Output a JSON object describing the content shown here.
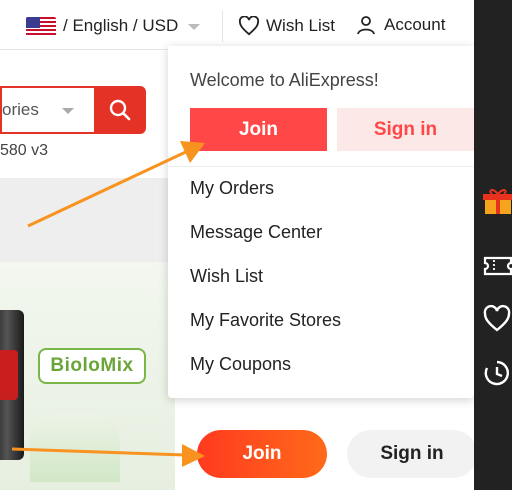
{
  "topbar": {
    "language": "/ English /  USD",
    "wish_list": "Wish List",
    "account": "Account"
  },
  "search": {
    "category": "ories",
    "below_text": "580 v3"
  },
  "product": {
    "brand": "BioloMix"
  },
  "dropdown": {
    "welcome": "Welcome to AliExpress!",
    "join": "Join",
    "sign_in": "Sign in",
    "items": [
      "My Orders",
      "Message Center",
      "Wish List",
      "My Favorite Stores",
      "My Coupons"
    ]
  },
  "bottom": {
    "join": "Join",
    "sign_in": "Sign in"
  },
  "sidebar": {
    "icons": [
      "gift-icon",
      "coupon-icon",
      "heart-icon",
      "history-icon"
    ]
  },
  "colors": {
    "brand_red": "#ff4747",
    "search_red": "#e43226",
    "arrow_orange": "#f7931e",
    "sidebar_bg": "#222222"
  }
}
